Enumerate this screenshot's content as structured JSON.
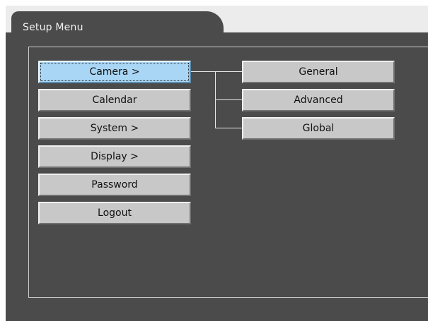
{
  "window": {
    "title": "Setup Menu"
  },
  "menu": {
    "items": [
      {
        "label": "Camera >"
      },
      {
        "label": "Calendar"
      },
      {
        "label": "System >"
      },
      {
        "label": "Display >"
      },
      {
        "label": "Password"
      },
      {
        "label": "Logout"
      }
    ],
    "selected_index": 0
  },
  "submenu": {
    "items": [
      {
        "label": "General"
      },
      {
        "label": "Advanced"
      },
      {
        "label": "Global"
      }
    ]
  },
  "colors": {
    "background": "#4b4b4b",
    "button_face": "#c8c8c8",
    "selected_face": "#a9d6f5",
    "border_light": "#f0f0f0",
    "border_dark": "#707070",
    "text_light": "#f2f2f2"
  }
}
